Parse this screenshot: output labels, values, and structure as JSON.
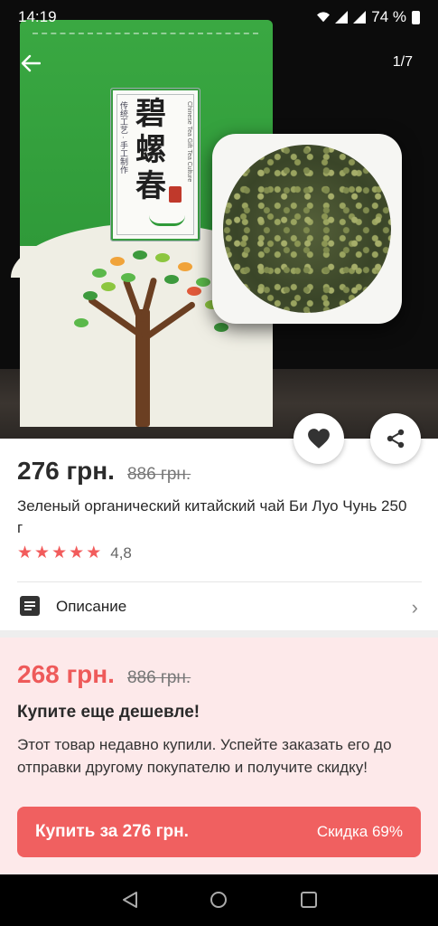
{
  "status_bar": {
    "time": "14:19",
    "battery": "74 %"
  },
  "gallery": {
    "counter": "1/7",
    "package_text": "碧螺春",
    "package_side_left": "传统工艺 · 手工制作",
    "package_side_right": "Chinese Tea Gift Tea Culture",
    "stamp_text": "茶"
  },
  "product": {
    "price": "276 грн.",
    "old_price": "886 грн.",
    "title": "Зеленый органический китайский чай Би Луо Чунь 250 г",
    "rating": "4,8",
    "stars": 5
  },
  "description": {
    "label": "Описание"
  },
  "promo": {
    "price": "268 грн.",
    "old_price": "886 грн.",
    "heading": "Купите еще дешевле!",
    "text": "Этот товар недавно купили. Успейте заказать его до отправки другому покупателю и получите скидку!",
    "buy_label": "Купить за 276 грн.",
    "discount_label": "Скидка 69%"
  },
  "colors": {
    "accent": "#f06060",
    "promo_bg": "#fde9ea",
    "star": "#f25c5c"
  },
  "icons": [
    "back-arrow-icon",
    "heart-icon",
    "share-icon",
    "description-icon",
    "chevron-right-icon",
    "nav-back-icon",
    "nav-home-icon",
    "nav-recents-icon"
  ]
}
